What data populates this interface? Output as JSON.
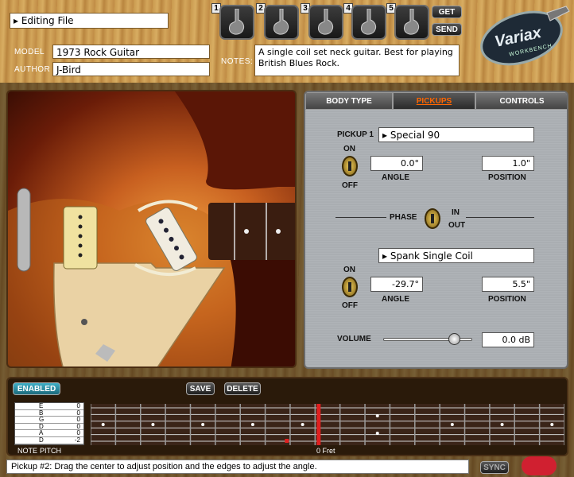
{
  "header": {
    "file_menu": "Editing File",
    "model_label": "MODEL",
    "model_value": "1973 Rock Guitar",
    "author_label": "AUTHOR",
    "author_value": "J-Bird",
    "notes_label": "NOTES:",
    "notes_value": "A single coil set neck guitar.  Best for playing British Blues Rock.",
    "slots": [
      "1",
      "2",
      "3",
      "4",
      "5"
    ],
    "get_label": "GET",
    "send_label": "SEND",
    "logo_text": "Variax",
    "logo_sub": "WORKBENCH"
  },
  "tabs": {
    "body": "BODY TYPE",
    "pickups": "PICKUPS",
    "controls": "CONTROLS"
  },
  "pickups": {
    "p1_label": "PICKUP 1",
    "p1_model": "Special 90",
    "p1_on": "ON",
    "p1_off": "OFF",
    "p1_angle": "0.0°",
    "p1_position": "1.0\"",
    "angle_label": "ANGLE",
    "position_label": "POSITION",
    "phase_label": "PHASE",
    "phase_in": "IN",
    "phase_out": "OUT",
    "p2_model": "Spank Single Coil",
    "p2_on": "ON",
    "p2_off": "OFF",
    "p2_angle": "-29.7°",
    "p2_position": "5.5\"",
    "volume_label": "VOLUME",
    "volume_value": "0.0 dB",
    "volume_level": 0.85
  },
  "tuning": {
    "enabled_label": "ENABLED",
    "save_label": "SAVE",
    "delete_label": "DELETE",
    "note_header": "NOTE",
    "pitch_header": "PITCH",
    "strings": [
      {
        "note": "E",
        "pitch": "0"
      },
      {
        "note": "B",
        "pitch": "0"
      },
      {
        "note": "G",
        "pitch": "0"
      },
      {
        "note": "D",
        "pitch": "0"
      },
      {
        "note": "A",
        "pitch": "0"
      },
      {
        "note": "D",
        "pitch": "-2"
      }
    ],
    "zero_fret_label": "0 Fret"
  },
  "status": {
    "message": "Pickup #2: Drag the center to adjust position and the edges to adjust the angle.",
    "sync_label": "SYNC"
  },
  "colors": {
    "active_tab": "#ff6600",
    "enabled_btn": "#2a8aa0"
  }
}
